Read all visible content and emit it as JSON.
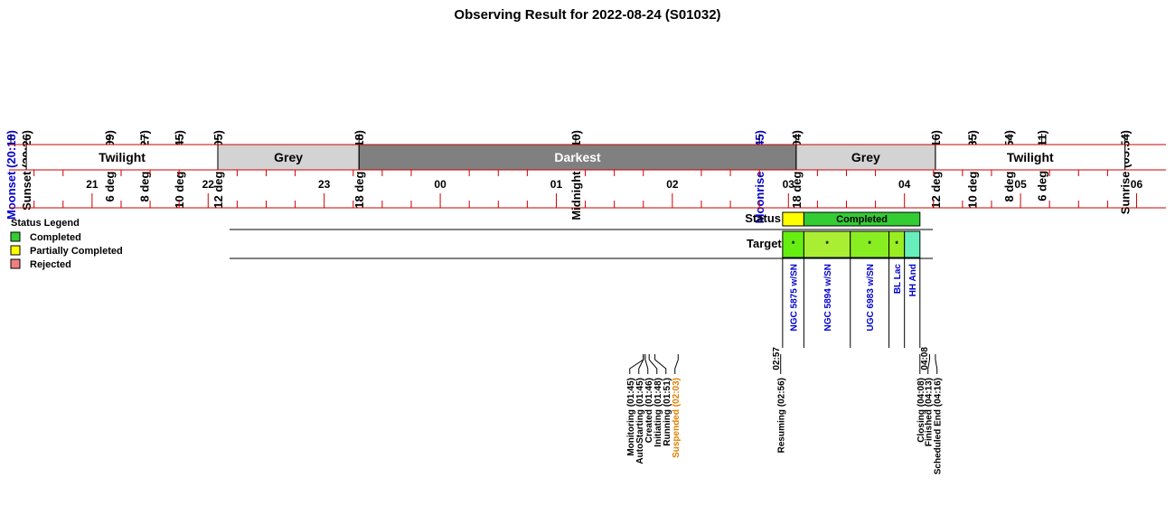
{
  "title": "Observing Result for 2022-08-24 (S01032)",
  "colors": {
    "line": "#cc0000",
    "moon_text": "#0000cc",
    "event_highlight": "#e08000",
    "twilight": "#ffffff",
    "grey": "#d3d3d3",
    "darkest": "#808080",
    "completed": "#33cc33",
    "partial": "#ffff00",
    "rejected": "#f08080",
    "target_a": "#66ee11",
    "target_b": "#aaee33",
    "target_c": "#88ee22",
    "target_d": "#99ee22",
    "target_e": "#66eebb"
  },
  "axis": {
    "start": "20:18",
    "end": "06:04",
    "hour_labels": [
      "21",
      "22",
      "23",
      "00",
      "01",
      "02",
      "03",
      "04",
      "05",
      "06"
    ]
  },
  "sky_events": [
    {
      "label": "Moonset (20:18)",
      "time": "20:18",
      "moon": true
    },
    {
      "label": "Sunset (20:26)",
      "time": "20:26",
      "moon": false
    },
    {
      "label": "6 deg (21:09)",
      "time": "21:09",
      "moon": false
    },
    {
      "label": "8 deg (21:27)",
      "time": "21:27",
      "moon": false
    },
    {
      "label": "10 deg (21:45)",
      "time": "21:45",
      "moon": false
    },
    {
      "label": "12 deg (22:05)",
      "time": "22:05",
      "moon": false
    },
    {
      "label": "18 deg (23:18)",
      "time": "23:18",
      "moon": false
    },
    {
      "label": "Midnight (01:10)",
      "time": "01:10",
      "moon": false
    },
    {
      "label": "Moonrise (02:45)",
      "time": "02:45",
      "moon": true
    },
    {
      "label": "18 deg (03:04)",
      "time": "03:04",
      "moon": false
    },
    {
      "label": "12 deg (04:16)",
      "time": "04:16",
      "moon": false
    },
    {
      "label": "10 deg (04:35)",
      "time": "04:35",
      "moon": false
    },
    {
      "label": "8 deg (04:54)",
      "time": "04:54",
      "moon": false
    },
    {
      "label": "6 deg (05:11)",
      "time": "05:11",
      "moon": false
    },
    {
      "label": "Sunrise (05:54)",
      "time": "05:54",
      "moon": false
    }
  ],
  "periods": [
    {
      "label": "Twilight",
      "start": "20:26",
      "end": "22:05",
      "kind": "twilight"
    },
    {
      "label": "Grey",
      "start": "22:05",
      "end": "23:18",
      "kind": "grey"
    },
    {
      "label": "Darkest",
      "start": "23:18",
      "end": "03:04",
      "kind": "darkest"
    },
    {
      "label": "Grey",
      "start": "03:04",
      "end": "04:16",
      "kind": "grey"
    },
    {
      "label": "Twilight",
      "start": "04:16",
      "end": "05:54",
      "kind": "twilight"
    }
  ],
  "legend": {
    "title": "Status Legend",
    "items": [
      {
        "label": "Completed",
        "color": "#33cc33"
      },
      {
        "label": "Partially Completed",
        "color": "#ffff00"
      },
      {
        "label": "Rejected",
        "color": "#f08080"
      }
    ]
  },
  "status_row": {
    "label": "Status",
    "segments": [
      {
        "start": "02:57",
        "end": "03:08",
        "label": "",
        "color": "#ffff00"
      },
      {
        "start": "03:08",
        "end": "04:08",
        "label": "Completed",
        "color": "#33cc33"
      }
    ]
  },
  "targets_row": {
    "label": "Targets",
    "start_time": "02:57",
    "end_time": "04:08",
    "targets": [
      {
        "name": "NGC 5875 w/SN",
        "start": "02:57",
        "end": "03:08",
        "mark": "*",
        "color": "#66ee11"
      },
      {
        "name": "NGC 5894 w/SN",
        "start": "03:08",
        "end": "03:32",
        "mark": "*",
        "color": "#aaee33"
      },
      {
        "name": "UGC 6983 w/SN",
        "start": "03:32",
        "end": "03:52",
        "mark": "*",
        "color": "#88ee22"
      },
      {
        "name": "BL Lac",
        "start": "03:52",
        "end": "04:00",
        "mark": "*",
        "color": "#99ee22"
      },
      {
        "name": "HH And",
        "start": "04:00",
        "end": "04:08",
        "mark": "",
        "color": "#66eebb"
      }
    ]
  },
  "run_events": [
    {
      "label": "Monitoring (01:45)",
      "time": "01:45",
      "highlight": false
    },
    {
      "label": "AutoStarting (01:45)",
      "time": "01:45",
      "highlight": false
    },
    {
      "label": "Created (01:46)",
      "time": "01:46",
      "highlight": false
    },
    {
      "label": "Initiating (01:48)",
      "time": "01:48",
      "highlight": false
    },
    {
      "label": "Running (01:51)",
      "time": "01:51",
      "highlight": false
    },
    {
      "label": "Suspended (02:03)",
      "time": "02:03",
      "highlight": true
    },
    {
      "label": "Resuming (02:56)",
      "time": "02:56",
      "highlight": false
    },
    {
      "label": "Closing (04:08)",
      "time": "04:08",
      "highlight": false
    },
    {
      "label": "Finished (04:13)",
      "time": "04:13",
      "highlight": false
    },
    {
      "label": "Scheduled End (04:16)",
      "time": "04:16",
      "highlight": false
    }
  ],
  "chart_data": {
    "type": "timeline",
    "title": "Observing Result for 2022-08-24 (S01032)",
    "x_axis": {
      "ticks": [
        "21",
        "22",
        "23",
        "00",
        "01",
        "02",
        "03",
        "04",
        "05",
        "06"
      ],
      "range": [
        "20:18",
        "06:04"
      ]
    },
    "periods": [
      {
        "name": "Twilight",
        "start": "20:26",
        "end": "22:05"
      },
      {
        "name": "Grey",
        "start": "22:05",
        "end": "23:18"
      },
      {
        "name": "Darkest",
        "start": "23:18",
        "end": "03:04"
      },
      {
        "name": "Grey",
        "start": "03:04",
        "end": "04:16"
      },
      {
        "name": "Twilight",
        "start": "04:16",
        "end": "05:54"
      }
    ],
    "status": [
      {
        "status": "Partially Completed",
        "start": "02:57",
        "end": "03:08"
      },
      {
        "status": "Completed",
        "start": "03:08",
        "end": "04:08"
      }
    ],
    "targets": [
      {
        "name": "NGC 5875 w/SN",
        "start": "02:57",
        "end": "03:08"
      },
      {
        "name": "NGC 5894 w/SN",
        "start": "03:08",
        "end": "03:32"
      },
      {
        "name": "UGC 6983 w/SN",
        "start": "03:32",
        "end": "03:52"
      },
      {
        "name": "BL Lac",
        "start": "03:52",
        "end": "04:00"
      },
      {
        "name": "HH And",
        "start": "04:00",
        "end": "04:08"
      }
    ]
  }
}
